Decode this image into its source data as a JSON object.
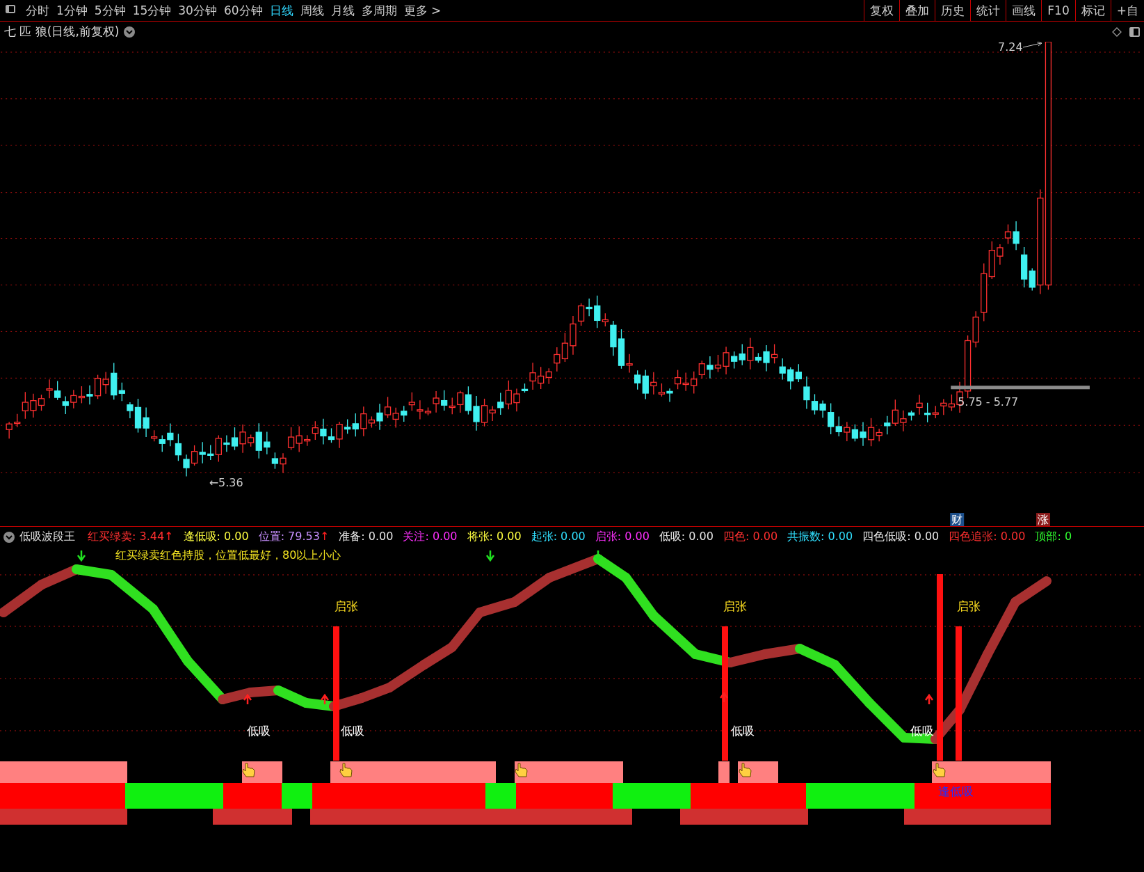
{
  "toolbar": {
    "periods": [
      {
        "label": "分时",
        "selected": false
      },
      {
        "label": "1分钟",
        "selected": false
      },
      {
        "label": "5分钟",
        "selected": false
      },
      {
        "label": "15分钟",
        "selected": false
      },
      {
        "label": "30分钟",
        "selected": false
      },
      {
        "label": "60分钟",
        "selected": false
      },
      {
        "label": "日线",
        "selected": true
      },
      {
        "label": "周线",
        "selected": false
      },
      {
        "label": "月线",
        "selected": false
      },
      {
        "label": "多周期",
        "selected": false
      },
      {
        "label": "更多 >",
        "selected": false
      }
    ],
    "actions": [
      "复权",
      "叠加",
      "历史",
      "统计",
      "画线",
      "F10",
      "标记",
      "+自"
    ]
  },
  "chart": {
    "title": "七 匹 狼(日线,前复权)",
    "high_label": "7.24",
    "low_label": "←5.36",
    "range_label": "5.75 - 5.77",
    "badges": [
      {
        "text": "财",
        "color": "#1c4f8c"
      },
      {
        "text": "涨",
        "color": "#8c1c1c"
      }
    ]
  },
  "indicator": {
    "title": "低吸波段王",
    "values": [
      {
        "text": "红买绿卖: 3.44",
        "arrow": "↑",
        "color": "#ff3030"
      },
      {
        "text": "逢低吸: 0.00",
        "color": "#ffff40"
      },
      {
        "text": "位置: 79.53",
        "arrow": "↑",
        "color": "#c890ff"
      },
      {
        "text": "准备: 0.00",
        "color": "#e8e8e8"
      },
      {
        "text": "关注: 0.00",
        "color": "#ff30ff"
      },
      {
        "text": "将张: 0.00",
        "color": "#ffff40"
      },
      {
        "text": "起张: 0.00",
        "color": "#30e0ff"
      },
      {
        "text": "启张: 0.00",
        "color": "#ff30ff"
      },
      {
        "text": "低吸: 0.00",
        "color": "#e8e8e8"
      },
      {
        "text": "四色: 0.00",
        "color": "#ff3030"
      },
      {
        "text": "共振数: 0.00",
        "color": "#30e0ff"
      },
      {
        "text": "四色低吸: 0.00",
        "color": "#e8e8e8"
      },
      {
        "text": "四色追张: 0.00",
        "color": "#ff3030"
      },
      {
        "text": "顶部: 0",
        "color": "#30ff30"
      }
    ],
    "note": "红买绿卖红色持股，位置低最好，80以上小心",
    "rise_labels": [
      "启张",
      "启张",
      "启张"
    ],
    "dip_labels": [
      "低吸",
      "低吸",
      "低吸",
      "低吸"
    ],
    "buy_label": "逢低吸"
  }
}
